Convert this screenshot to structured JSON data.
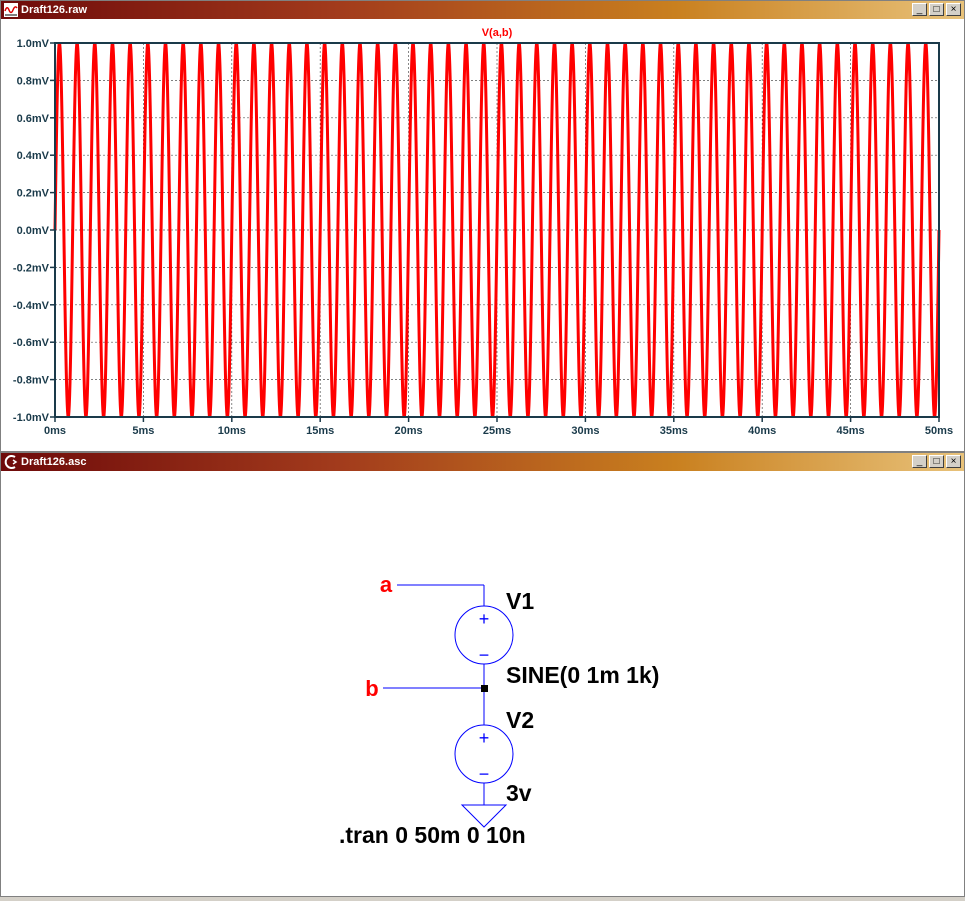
{
  "plot_window": {
    "title": "Draft126.raw",
    "buttons": [
      "_",
      "□",
      "×"
    ]
  },
  "schematic_window": {
    "title": "Draft126.asc",
    "buttons": [
      "_",
      "□",
      "×"
    ]
  },
  "colors": {
    "trace": "#ff0000",
    "schematic_wire": "#0000ff",
    "net_label": "#ff0000",
    "plot_frame": "#1a3a4a"
  },
  "chart_data": {
    "type": "line",
    "title": "V(a,b)",
    "series": [
      {
        "name": "V(a,b)",
        "kind": "sine",
        "amplitude_mV": 1.0,
        "frequency_hz": 1000
      }
    ],
    "xlabel": "",
    "ylabel": "",
    "xlim_ms": [
      0,
      50
    ],
    "ylim_mV": [
      -1.0,
      1.0
    ],
    "x_ticks": [
      "0ms",
      "5ms",
      "10ms",
      "15ms",
      "20ms",
      "25ms",
      "30ms",
      "35ms",
      "40ms",
      "45ms",
      "50ms"
    ],
    "x_tick_values": [
      0,
      5,
      10,
      15,
      20,
      25,
      30,
      35,
      40,
      45,
      50
    ],
    "y_ticks": [
      "1.0mV",
      "0.8mV",
      "0.6mV",
      "0.4mV",
      "0.2mV",
      "0.0mV",
      "-0.2mV",
      "-0.4mV",
      "-0.6mV",
      "-0.8mV",
      "-1.0mV"
    ],
    "y_tick_values": [
      1.0,
      0.8,
      0.6,
      0.4,
      0.2,
      0.0,
      -0.2,
      -0.4,
      -0.6,
      -0.8,
      -1.0
    ],
    "grid": true
  },
  "schematic": {
    "net_a": "a",
    "net_b": "b",
    "v1_name": "V1",
    "v1_value": "SINE(0 1m 1k)",
    "v2_name": "V2",
    "v2_value": "3v",
    "directive": ".tran 0 50m 0 10n"
  }
}
